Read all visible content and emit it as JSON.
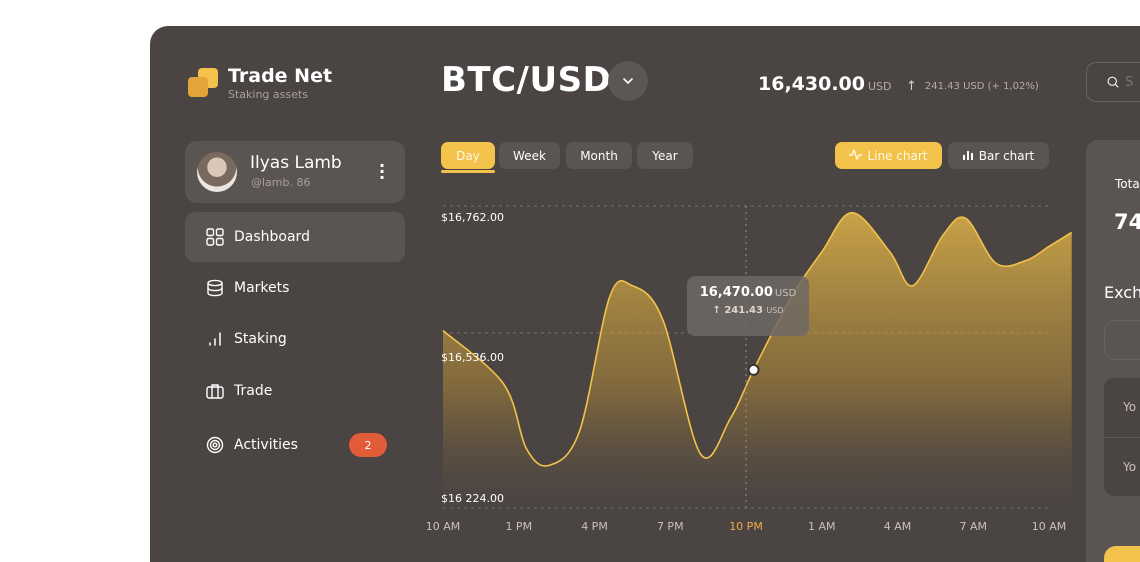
{
  "brand": {
    "title": "Trade Net",
    "subtitle": "Staking assets"
  },
  "profile": {
    "name": "Ilyas Lamb",
    "handle": "@lamb. 86",
    "menu_icon": "more-vertical-icon"
  },
  "nav": [
    {
      "label": "Dashboard",
      "icon": "grid-icon",
      "active": true
    },
    {
      "label": "Markets",
      "icon": "database-icon"
    },
    {
      "label": "Staking",
      "icon": "signal-bars-icon"
    },
    {
      "label": "Trade",
      "icon": "briefcase-icon"
    },
    {
      "label": "Activities",
      "icon": "target-icon",
      "badge": "2"
    }
  ],
  "header": {
    "pair": "BTC/USD",
    "price": "16,430.00",
    "price_currency": "USD",
    "change": "241.43 USD (+ 1,02%)",
    "search_placeholder": "S"
  },
  "period_tabs": [
    "Day",
    "Week",
    "Month",
    "Year"
  ],
  "active_period": "Day",
  "chart_tabs": {
    "line": "Line chart",
    "bar": "Bar chart",
    "active": "line"
  },
  "chart_data": {
    "type": "area",
    "title": "",
    "xlabel": "",
    "ylabel": "",
    "x": [
      "10 AM",
      "1 PM",
      "4 PM",
      "7 PM",
      "10 PM",
      "1 AM",
      "4 AM",
      "7 AM",
      "10 AM"
    ],
    "y_ticks": [
      "$16,762.00",
      "$16,536.00",
      "$16 224.00"
    ],
    "ylim": [
      16224,
      16762
    ],
    "active_x": "10 PM",
    "series": [
      {
        "points": [
          [
            0,
            16540
          ],
          [
            0.8,
            16445
          ],
          [
            1.1,
            16330
          ],
          [
            1.4,
            16300
          ],
          [
            1.8,
            16360
          ],
          [
            2.2,
            16600
          ],
          [
            2.5,
            16620
          ],
          [
            2.9,
            16560
          ],
          [
            3.4,
            16320
          ],
          [
            3.8,
            16385
          ],
          [
            4.1,
            16470
          ],
          [
            4.6,
            16600
          ],
          [
            5.0,
            16680
          ],
          [
            5.4,
            16750
          ],
          [
            5.9,
            16680
          ],
          [
            6.2,
            16620
          ],
          [
            6.6,
            16710
          ],
          [
            6.9,
            16740
          ],
          [
            7.3,
            16660
          ],
          [
            7.7,
            16665
          ],
          [
            8.0,
            16690
          ],
          [
            8.3,
            16715
          ]
        ]
      }
    ],
    "grid": true,
    "tooltip": {
      "price": "16,470.00",
      "currency": "USD",
      "change": "241.43",
      "change_unit": "USD"
    }
  },
  "right_panel": {
    "total_label": "Tota",
    "total_value": "74",
    "exchange_label": "Exch",
    "you_pay": "Yo",
    "you_get": "Yo"
  },
  "colors": {
    "accent": "#f3c24a",
    "background": "#4a4442",
    "card": "#5a5452",
    "badge": "#e25c3a"
  }
}
